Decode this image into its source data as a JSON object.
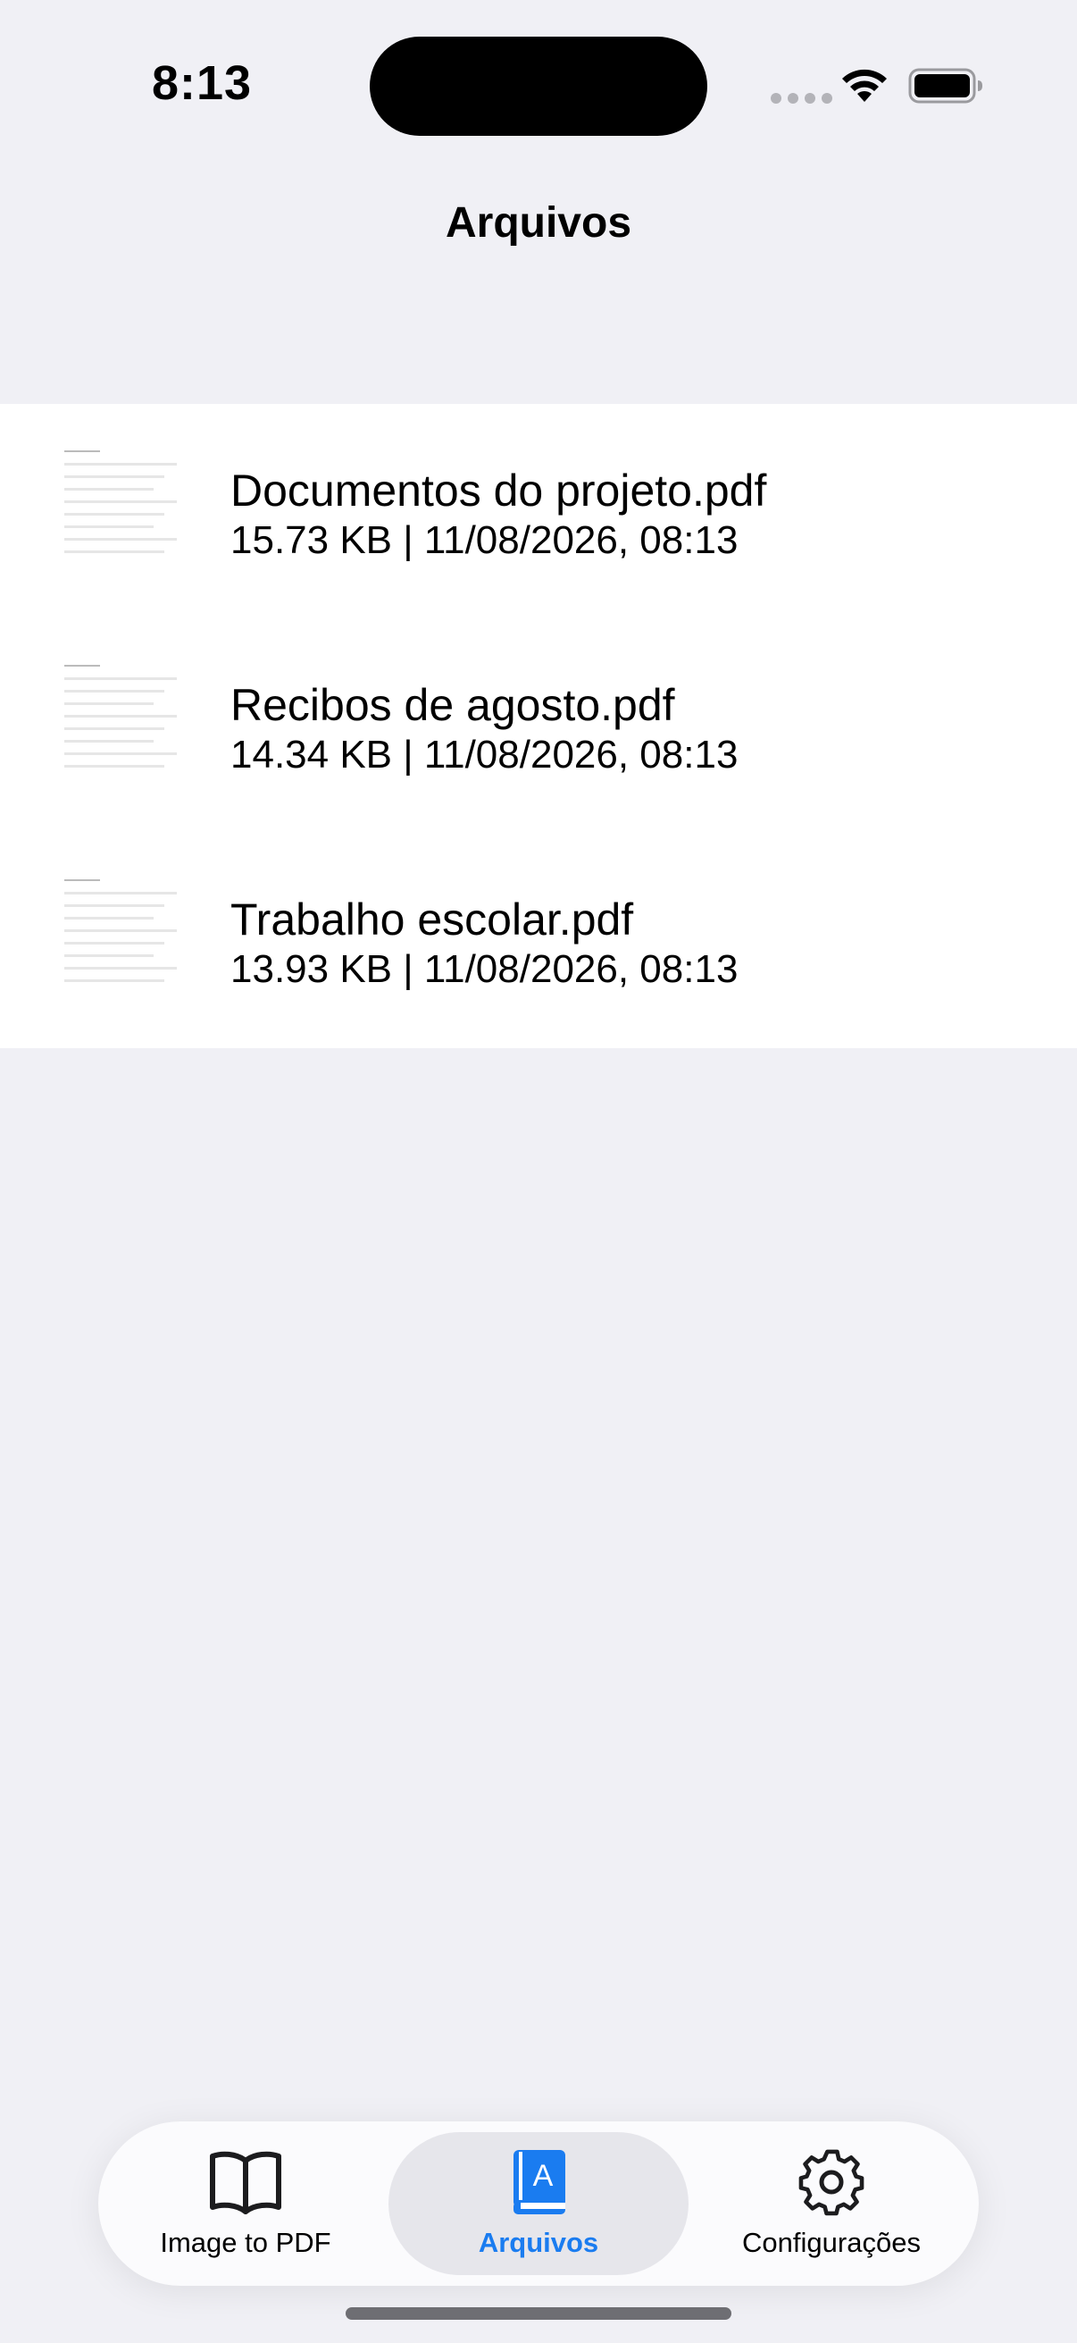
{
  "status_bar": {
    "time": "8:13"
  },
  "navigation": {
    "title": "Arquivos"
  },
  "files": [
    {
      "name": "Documentos do projeto.pdf",
      "meta": "15.73 KB | 11/08/2026, 08:13",
      "thumbnail_icon": "pdf-thumbnail-icon"
    },
    {
      "name": "Recibos de agosto.pdf",
      "meta": "14.34 KB | 11/08/2026, 08:13",
      "thumbnail_icon": "pdf-thumbnail-icon"
    },
    {
      "name": "Trabalho escolar.pdf",
      "meta": "13.93 KB | 11/08/2026, 08:13",
      "thumbnail_icon": "pdf-thumbnail-icon"
    }
  ],
  "tab_bar": {
    "tabs": [
      {
        "label": "Image to PDF",
        "icon": "open-book-icon",
        "selected": false
      },
      {
        "label": "Arquivos",
        "icon": "book-icon",
        "selected": true
      },
      {
        "label": "Configurações",
        "icon": "gear-icon",
        "selected": false
      }
    ]
  },
  "colors": {
    "accent": "#1a7cf0",
    "background": "#f0f0f5",
    "list_background": "#ffffff"
  }
}
